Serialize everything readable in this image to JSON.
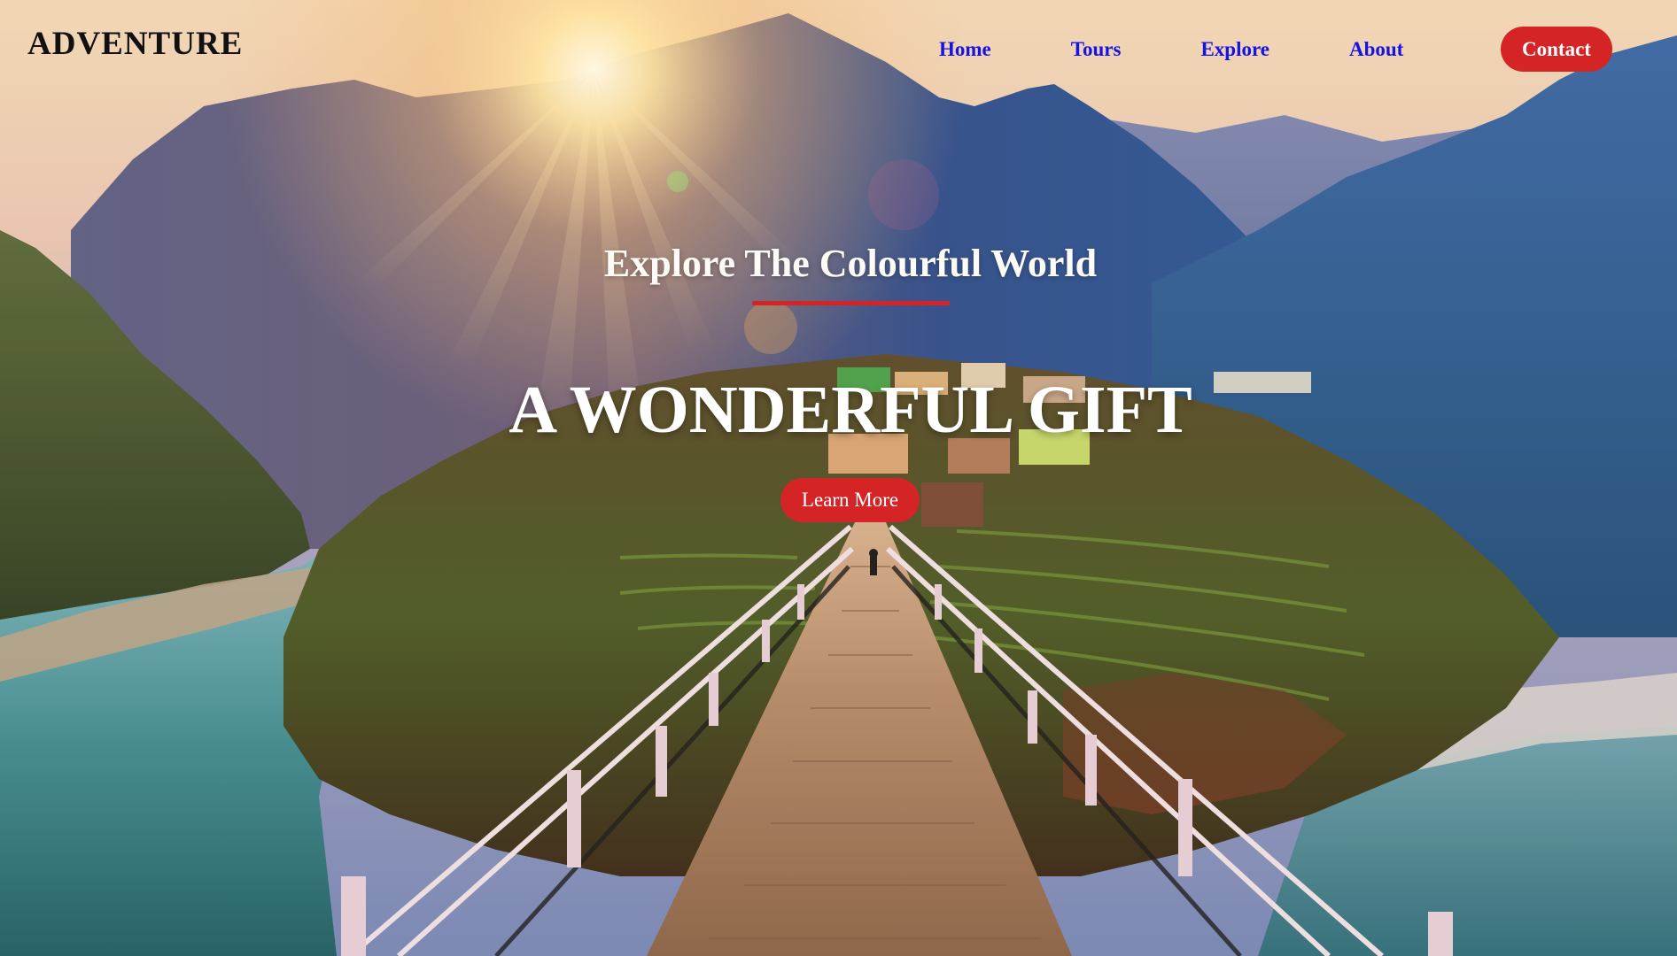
{
  "brand": {
    "logo_text": "ADVENTURE"
  },
  "nav": {
    "items": [
      {
        "label": "Home"
      },
      {
        "label": "Tours"
      },
      {
        "label": "Explore"
      },
      {
        "label": "About"
      }
    ],
    "contact_label": "Contact"
  },
  "hero": {
    "subtitle": "Explore The Colourful World",
    "headline": "A WONDERFUL GIFT",
    "cta_label": "Learn More",
    "background_image": "mountain-valley-suspension-bridge-at-sunrise"
  },
  "colors": {
    "accent": "#d42425",
    "nav_link": "#1414e6",
    "logo": "#111111",
    "hero_text": "#ffffff"
  }
}
